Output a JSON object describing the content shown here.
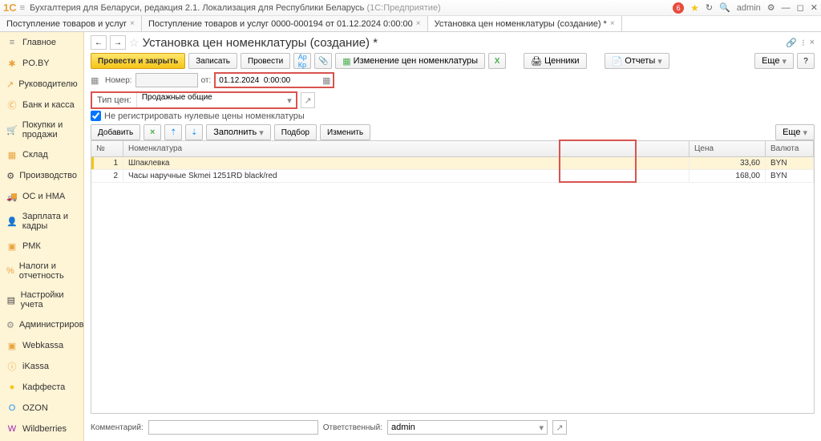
{
  "header": {
    "title_main": "Бухгалтерия для Беларуси, редакция 2.1. Локализация для Республики Беларусь",
    "title_sub": "(1С:Предприятие)",
    "user": "admin",
    "bell_count": "6"
  },
  "tabs": [
    {
      "label": "Поступление товаров и услуг"
    },
    {
      "label": "Поступление товаров и услуг 0000-000194 от 01.12.2024 0:00:00"
    },
    {
      "label": "Установка цен номенклатуры (создание) *"
    }
  ],
  "sidebar": [
    {
      "icon": "≡",
      "label": "Главное",
      "color": "#888"
    },
    {
      "icon": "✱",
      "label": "PO.BY",
      "color": "#e8a33d"
    },
    {
      "icon": "↗",
      "label": "Руководителю",
      "color": "#e8a33d"
    },
    {
      "icon": "Ⓒ",
      "label": "Банк и касса",
      "color": "#e8a33d"
    },
    {
      "icon": "🛒",
      "label": "Покупки и продажи",
      "color": "#444"
    },
    {
      "icon": "▦",
      "label": "Склад",
      "color": "#e8a33d"
    },
    {
      "icon": "⚙",
      "label": "Производство",
      "color": "#444"
    },
    {
      "icon": "🚚",
      "label": "ОС и НМА",
      "color": "#444"
    },
    {
      "icon": "👤",
      "label": "Зарплата и кадры",
      "color": "#e8a33d"
    },
    {
      "icon": "▣",
      "label": "РМК",
      "color": "#e8a33d"
    },
    {
      "icon": "%",
      "label": "Налоги и отчетность",
      "color": "#e8a33d"
    },
    {
      "icon": "▤",
      "label": "Настройки учета",
      "color": "#444"
    },
    {
      "icon": "⚙",
      "label": "Администрирование",
      "color": "#888"
    },
    {
      "icon": "▣",
      "label": "Webkassa",
      "color": "#e8a33d"
    },
    {
      "icon": "ⓘ",
      "label": "iKassa",
      "color": "#e8a33d"
    },
    {
      "icon": "●",
      "label": "Каффеста",
      "color": "#f5c518"
    },
    {
      "icon": "O",
      "label": "OZON",
      "color": "#2196f3"
    },
    {
      "icon": "W",
      "label": "Wildberries",
      "color": "#9c27b0"
    }
  ],
  "page": {
    "title": "Установка цен номенклатуры (создание) *",
    "btn_post_close": "Провести и закрыть",
    "btn_save": "Записать",
    "btn_post": "Провести",
    "btn_price_change": "Изменение цен номенклатуры",
    "btn_pricetags": "Ценники",
    "btn_reports": "Отчеты",
    "btn_more": "Еще",
    "number_label": "Номер:",
    "from_label": "от:",
    "date_value": "01.12.2024  0:00:00",
    "type_label": "Тип цен:",
    "type_value": "Продажные общие",
    "checkbox_label": "Не регистрировать нулевые цены номенклатуры",
    "btn_add": "Добавить",
    "btn_fill": "Заполнить",
    "btn_select": "Подбор",
    "btn_edit": "Изменить",
    "comment_label": "Комментарий:",
    "responsible_label": "Ответственный:",
    "responsible_value": "admin"
  },
  "table": {
    "headers": {
      "num": "№",
      "name": "Номенклатура",
      "price": "Цена",
      "currency": "Валюта"
    },
    "rows": [
      {
        "num": "1",
        "name": "Шпаклевка",
        "price": "33,60",
        "currency": "BYN"
      },
      {
        "num": "2",
        "name": "Часы наручные Skmei 1251RD black/red",
        "price": "168,00",
        "currency": "BYN"
      }
    ]
  }
}
